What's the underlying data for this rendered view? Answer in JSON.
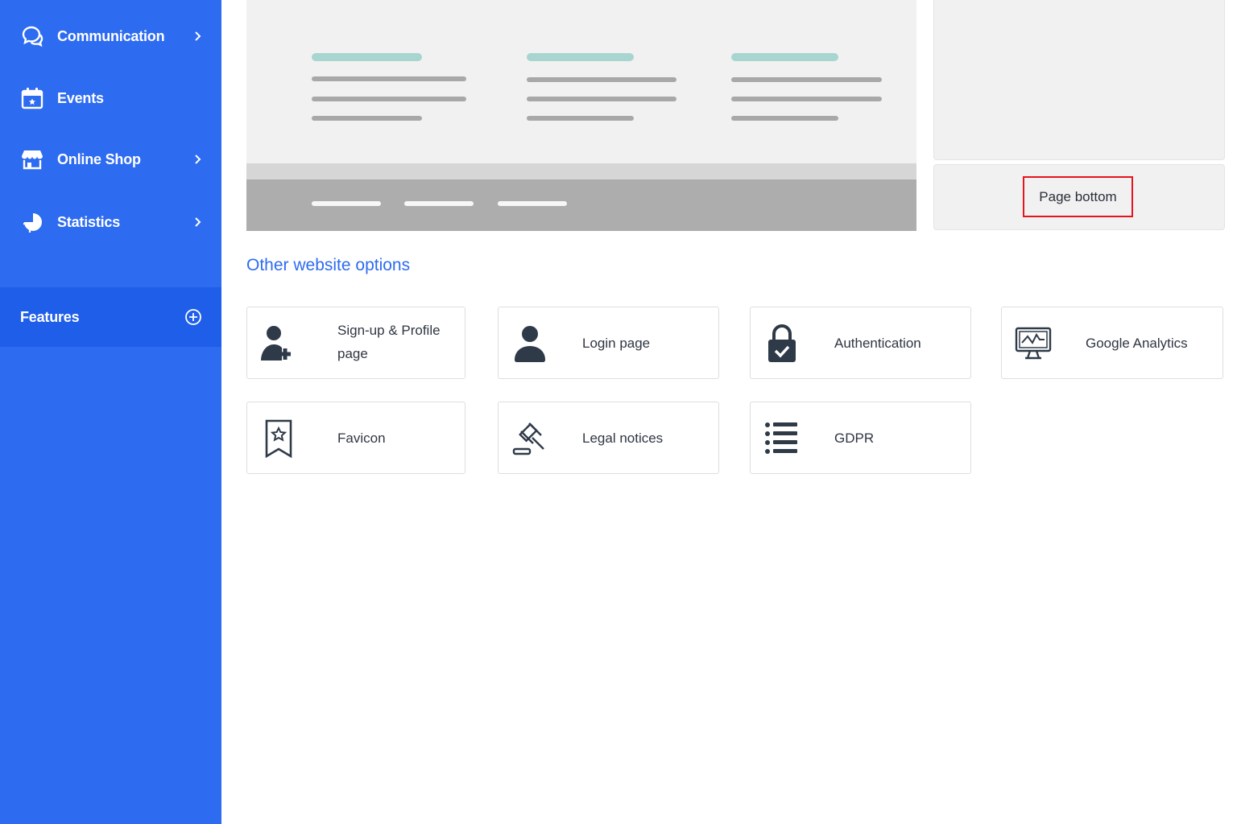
{
  "sidebar": {
    "items": [
      {
        "label": "Communication",
        "icon": "chat-bubbles-icon",
        "has_submenu": true
      },
      {
        "label": "Events",
        "icon": "calendar-icon",
        "has_submenu": false
      },
      {
        "label": "Online Shop",
        "icon": "storefront-icon",
        "has_submenu": true
      },
      {
        "label": "Statistics",
        "icon": "pie-chart-icon",
        "has_submenu": true
      }
    ],
    "features": {
      "label": "Features",
      "icon": "plus-circle-icon"
    },
    "colors": {
      "background": "#2d6bf0",
      "active": "#1e5ee8"
    }
  },
  "main": {
    "page_bottom_button": "Page bottom",
    "section_title": "Other website options",
    "options": [
      {
        "label": "Sign-up & Profile page",
        "icon": "user-add-icon"
      },
      {
        "label": "Login page",
        "icon": "user-icon"
      },
      {
        "label": "Authentication",
        "icon": "lock-check-icon"
      },
      {
        "label": "Google Analytics",
        "icon": "monitor-chart-icon"
      },
      {
        "label": "Favicon",
        "icon": "bookmark-star-icon"
      },
      {
        "label": "Legal notices",
        "icon": "gavel-icon"
      },
      {
        "label": "GDPR",
        "icon": "list-icon"
      }
    ],
    "colors": {
      "accent": "#2d6bf0",
      "highlight": "#e5141e"
    }
  }
}
